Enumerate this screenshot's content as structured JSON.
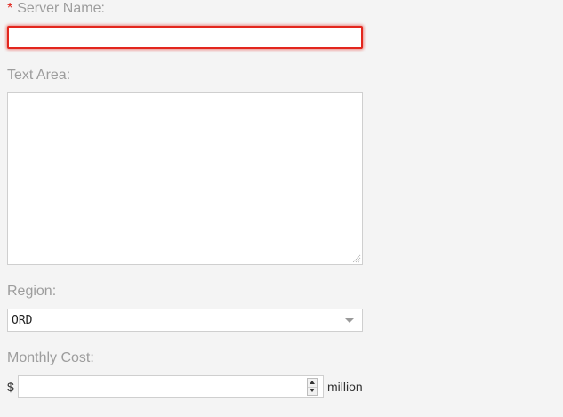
{
  "form": {
    "server_name": {
      "required_mark": "*",
      "label": "Server Name:",
      "value": "",
      "error_color": "#e3261d"
    },
    "text_area": {
      "label": "Text Area:",
      "value": ""
    },
    "region": {
      "label": "Region:",
      "selected": "ORD"
    },
    "monthly_cost": {
      "label": "Monthly Cost:",
      "prefix": "$",
      "value": "",
      "suffix": "million"
    }
  }
}
